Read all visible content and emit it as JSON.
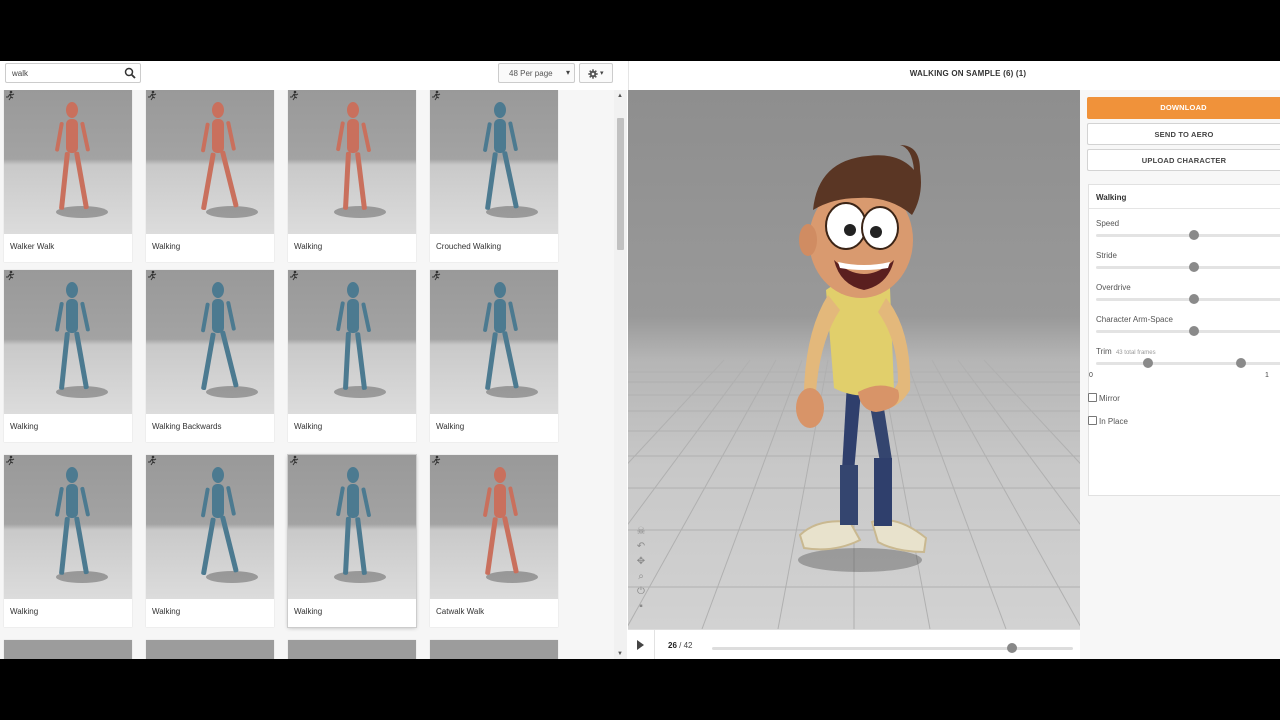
{
  "search": {
    "value": "walk",
    "icon": "search-icon"
  },
  "per_page": {
    "selected": "48 Per page"
  },
  "settings_button": {
    "icon": "gear-icon"
  },
  "grid": {
    "cards": [
      {
        "label": "Walker Walk",
        "color": "#c9705d"
      },
      {
        "label": "Walking",
        "color": "#c9705d"
      },
      {
        "label": "Walking",
        "color": "#c9705d"
      },
      {
        "label": "Crouched Walking",
        "color": "#4c7a90"
      },
      {
        "label": "Walking",
        "color": "#4c7a90"
      },
      {
        "label": "Walking Backwards",
        "color": "#4c7a90"
      },
      {
        "label": "Walking",
        "color": "#4c7a90"
      },
      {
        "label": "Walking",
        "color": "#4c7a90"
      },
      {
        "label": "Walking",
        "color": "#4c7a90"
      },
      {
        "label": "Walking",
        "color": "#4c7a90"
      },
      {
        "label": "Walking",
        "color": "#4c7a90",
        "selected": true
      },
      {
        "label": "Catwalk Walk",
        "color": "#c9705d"
      }
    ]
  },
  "viewer": {
    "title": "WALKING ON SAMPLE (6) (1)",
    "tools": [
      "skull-icon",
      "undo-icon",
      "move-icon",
      "zoom-icon",
      "power-icon",
      "camera-icon"
    ],
    "frame_current": "26",
    "frame_separator": "/",
    "frame_total": "42",
    "playhead_fraction": 0.83
  },
  "side": {
    "download": "DOWNLOAD",
    "send_to_aero": "SEND TO AERO",
    "upload_character": "UPLOAD CHARACTER",
    "animation_name": "Walking",
    "speed_label": "Speed",
    "stride_label": "Stride",
    "overdrive_label": "Overdrive",
    "arm_space_label": "Character Arm-Space",
    "trim_label": "Trim",
    "trim_frames": "43 total frames",
    "trim_min": "0",
    "trim_max": "1",
    "mirror_label": "Mirror",
    "in_place_label": "In Place",
    "accent_color": "#f0923a"
  }
}
